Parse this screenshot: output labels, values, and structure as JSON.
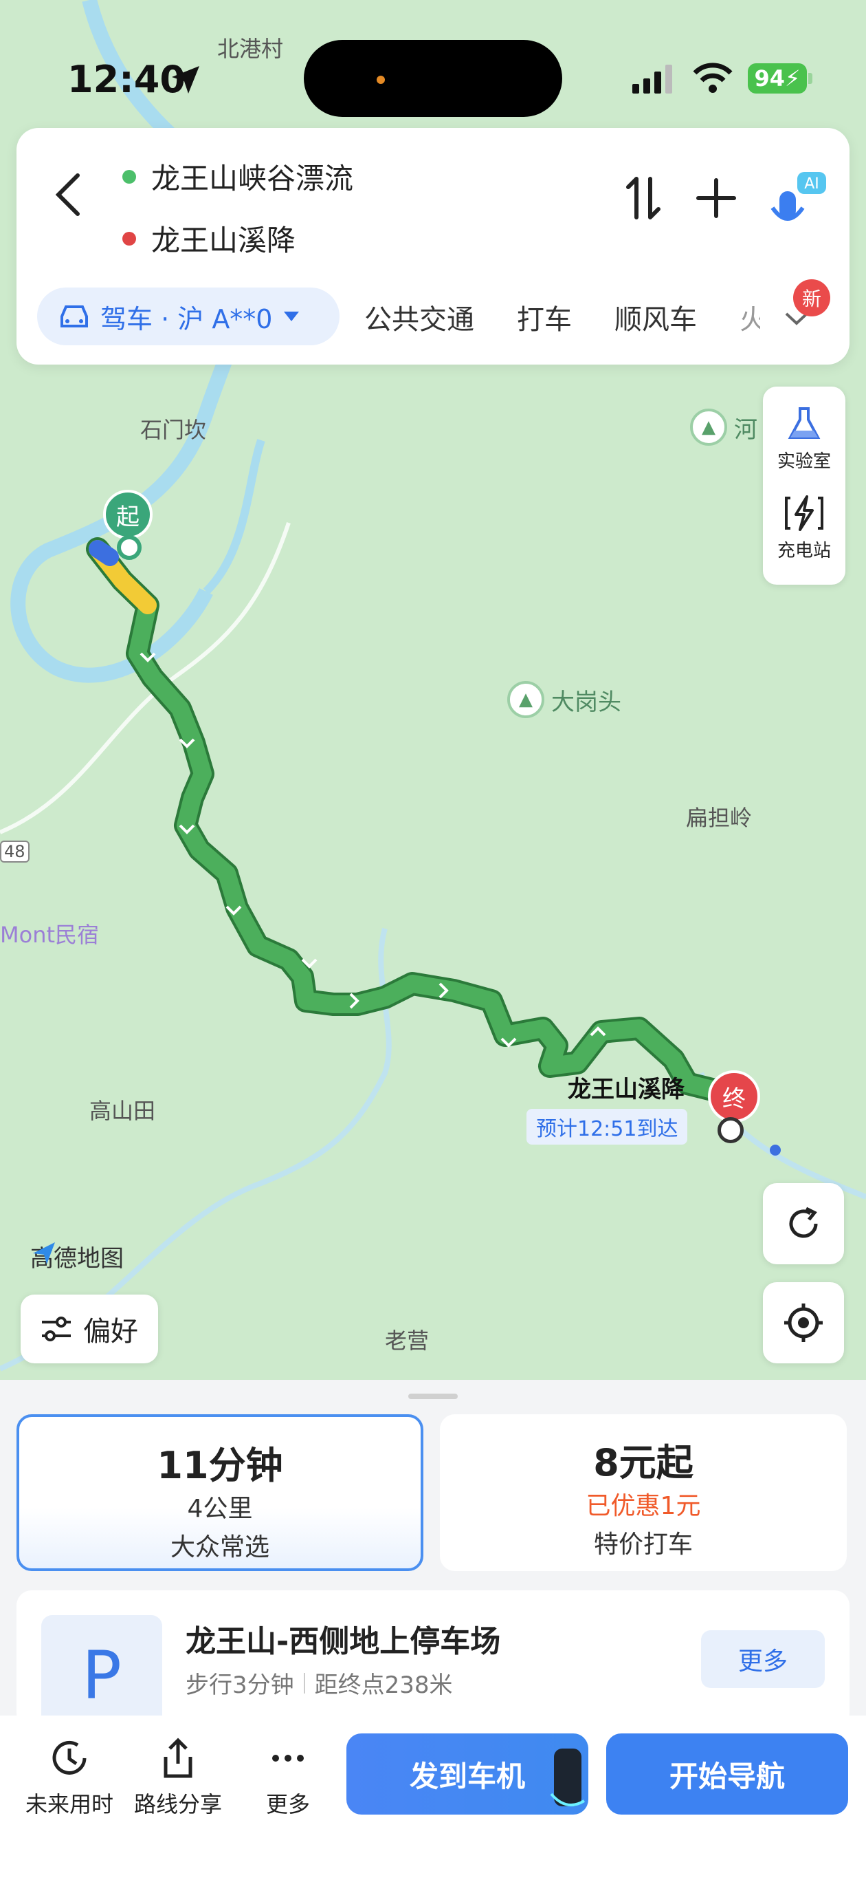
{
  "status_bar": {
    "time": "12:40",
    "battery": "94"
  },
  "route": {
    "origin": "龙王山峡谷漂流",
    "destination": "龙王山溪降",
    "mode_pill": "驾车 · 沪 A**0",
    "tabs": [
      "公共交通",
      "打车",
      "顺风车",
      "火"
    ],
    "new_badge": "新"
  },
  "map": {
    "labels": [
      "北港村",
      "石门坎",
      "高山田",
      "扁担岭",
      "老营",
      "Mont民宿",
      "48",
      "河"
    ],
    "poi_dagang": "大岗头",
    "start_marker": "起",
    "end_marker": "终",
    "end_name": "龙王山溪降",
    "eta": "预计12:51到达",
    "logo": "高德地图"
  },
  "tools": {
    "lab": "实验室",
    "charging": "充电站"
  },
  "preference_button": "偏好",
  "options": {
    "drive": {
      "time": "11分钟",
      "distance": "4公里",
      "tag": "大众常选"
    },
    "taxi": {
      "price": "8元起",
      "discount": "已优惠1元",
      "tag": "特价打车"
    }
  },
  "parking": {
    "icon_letter": "P",
    "name": "龙王山-西侧地上停车场",
    "walk": "步行3分钟",
    "distance": "距终点238米",
    "more": "更多"
  },
  "bottom_actions": {
    "future": "未来用时",
    "share": "路线分享",
    "more": "更多",
    "send_car": "发到车机",
    "start_nav": "开始导航"
  },
  "colors": {
    "route": "#4caf5c",
    "accent": "#3d82f2",
    "end_marker": "#e5464b",
    "start_marker": "#3aa67a",
    "discount": "#f05a2a"
  }
}
